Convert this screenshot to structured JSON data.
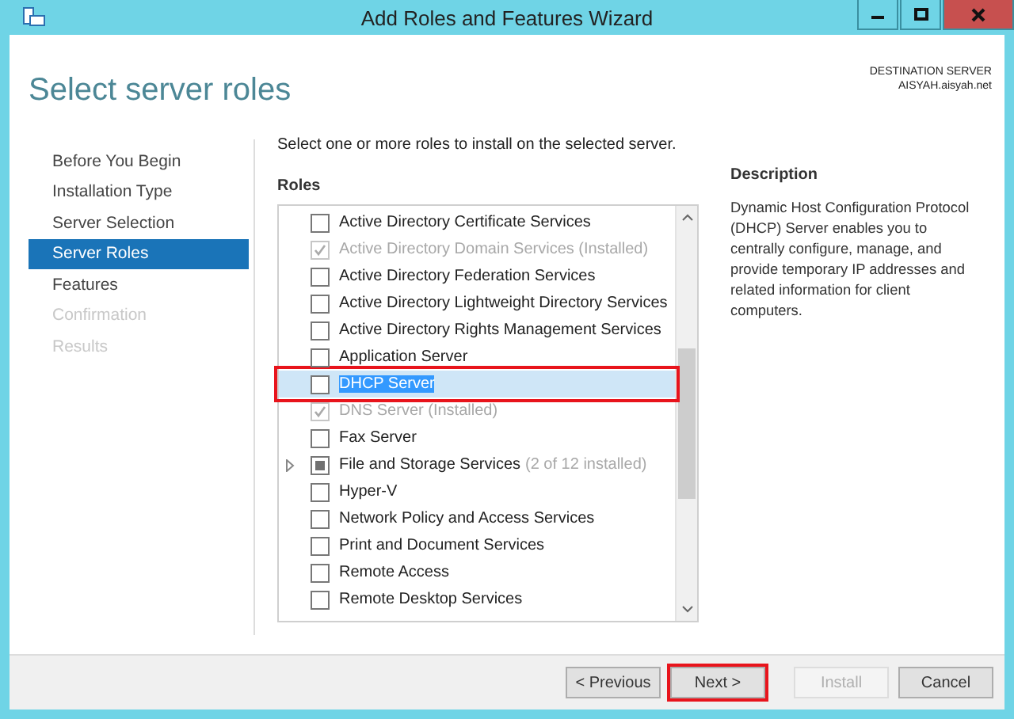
{
  "window": {
    "title": "Add Roles and Features Wizard"
  },
  "header": {
    "title": "Select server roles",
    "destination_label": "DESTINATION SERVER",
    "destination_server": "AISYAH.aisyah.net"
  },
  "steps": [
    {
      "label": "Before You Begin",
      "selected": false,
      "disabled": false
    },
    {
      "label": "Installation Type",
      "selected": false,
      "disabled": false
    },
    {
      "label": "Server Selection",
      "selected": false,
      "disabled": false
    },
    {
      "label": "Server Roles",
      "selected": true,
      "disabled": false
    },
    {
      "label": "Features",
      "selected": false,
      "disabled": false
    },
    {
      "label": "Confirmation",
      "selected": false,
      "disabled": true
    },
    {
      "label": "Results",
      "selected": false,
      "disabled": true
    }
  ],
  "intro": "Select one or more roles to install on the selected server.",
  "roles_heading": "Roles",
  "roles": [
    {
      "label": "Active Directory Certificate Services",
      "checked": false,
      "disabled": false,
      "selected": false,
      "highlighted": false
    },
    {
      "label": "Active Directory Domain Services (Installed)",
      "checked": true,
      "disabled": true,
      "selected": false,
      "highlighted": false
    },
    {
      "label": "Active Directory Federation Services",
      "checked": false,
      "disabled": false,
      "selected": false,
      "highlighted": false
    },
    {
      "label": "Active Directory Lightweight Directory Services",
      "checked": false,
      "disabled": false,
      "selected": false,
      "highlighted": false
    },
    {
      "label": "Active Directory Rights Management Services",
      "checked": false,
      "disabled": false,
      "selected": false,
      "highlighted": false
    },
    {
      "label": "Application Server",
      "checked": false,
      "disabled": false,
      "selected": false,
      "highlighted": false
    },
    {
      "label": "DHCP Server",
      "checked": false,
      "disabled": false,
      "selected": true,
      "highlighted": true
    },
    {
      "label": "DNS Server (Installed)",
      "checked": true,
      "disabled": true,
      "selected": false,
      "highlighted": false
    },
    {
      "label": "Fax Server",
      "checked": false,
      "disabled": false,
      "selected": false,
      "highlighted": false
    },
    {
      "label": "File and Storage Services",
      "note": "(2 of 12 installed)",
      "checked": false,
      "partial": true,
      "expandable": true,
      "disabled": false,
      "selected": false,
      "highlighted": false
    },
    {
      "label": "Hyper-V",
      "checked": false,
      "disabled": false,
      "selected": false,
      "highlighted": false
    },
    {
      "label": "Network Policy and Access Services",
      "checked": false,
      "disabled": false,
      "selected": false,
      "highlighted": false
    },
    {
      "label": "Print and Document Services",
      "checked": false,
      "disabled": false,
      "selected": false,
      "highlighted": false
    },
    {
      "label": "Remote Access",
      "checked": false,
      "disabled": false,
      "selected": false,
      "highlighted": false
    },
    {
      "label": "Remote Desktop Services",
      "checked": false,
      "disabled": false,
      "selected": false,
      "highlighted": false
    }
  ],
  "description": {
    "heading": "Description",
    "text": "Dynamic Host Configuration Protocol (DHCP) Server enables you to centrally configure, manage, and provide temporary IP addresses and related information for client computers."
  },
  "buttons": [
    {
      "label": "< Previous",
      "disabled": false,
      "highlighted": false
    },
    {
      "label": "Next >",
      "disabled": false,
      "highlighted": true
    },
    {
      "label": "Install",
      "disabled": true,
      "highlighted": false
    },
    {
      "label": "Cancel",
      "disabled": false,
      "highlighted": false
    }
  ]
}
